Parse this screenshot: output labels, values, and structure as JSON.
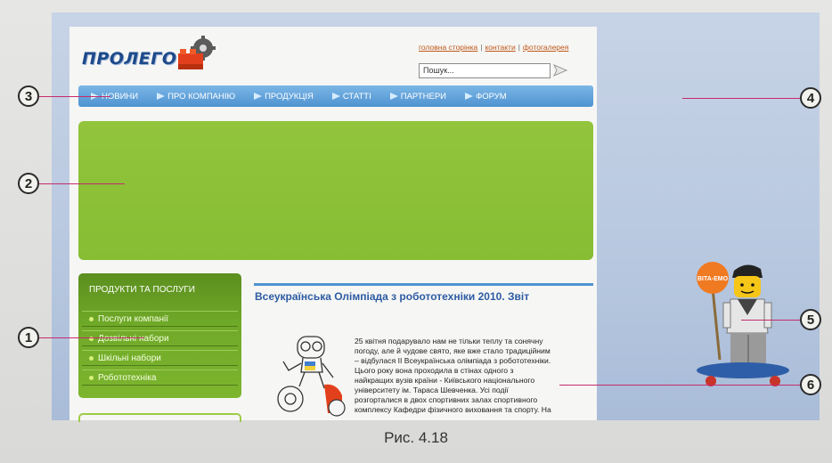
{
  "site": {
    "logo": "ПРОЛЕГО",
    "top_links": [
      "головна сторінка",
      "контакти",
      "фотогалерея"
    ],
    "search_placeholder": "Пошук...",
    "nav": [
      "НОВИНИ",
      "ПРО КОМПАНІЮ",
      "ПРОДУКЦІЯ",
      "СТАТТІ",
      "ПАРТНЕРИ",
      "ФОРУМ"
    ],
    "sidebar": {
      "title": "ПРОДУКТИ ТА ПОСЛУГИ",
      "items": [
        "Послуги компанії",
        "Дозвільні набори",
        "Шкільні набори",
        "Робототехніка"
      ]
    },
    "headline": "Всеукраїнська Олімпіада з робототехніки 2010. Звіт",
    "article_lines": [
      "25 квітня подарувало нам не тільки теплу та сонячну",
      "погоду, але й чудове свято, яке вже стало традиційним",
      "– відбулася II Всеукраїнська олімпіада з робототехніки.",
      "Цього року вона проходила в стінах одного з",
      "найкращих вузів країни - Київського національного",
      "університету ім. Тараса Шевченка. Усі події",
      "розгорталися в двох спортивних залах спортивного",
      "комплексу Кафедри фізичного виховання та спорту. На"
    ],
    "sign_text": "BITA-EMO"
  },
  "callouts": [
    "1",
    "2",
    "3",
    "4",
    "5",
    "6"
  ],
  "caption": "Рис. 4.18",
  "colors": {
    "nav": "#4f93d1",
    "banner": "#8cc138",
    "sidebar": "#6fa928",
    "callout_line": "#c42c6b"
  }
}
